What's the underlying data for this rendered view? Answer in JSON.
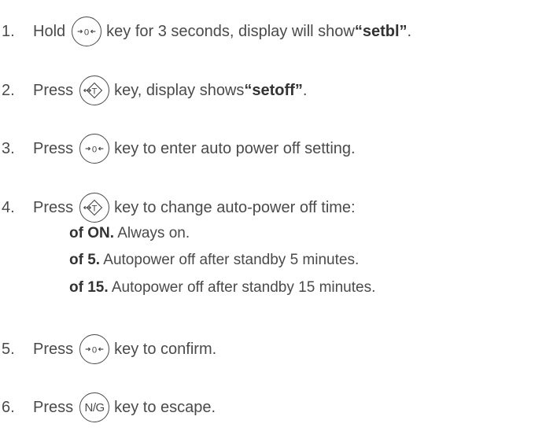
{
  "steps": [
    {
      "num": "1.",
      "before": "Hold",
      "key": "zero-key",
      "after": "key for 3 seconds, display will show ",
      "bold": "“setbl”",
      "tail": "."
    },
    {
      "num": "2.",
      "before": "Press",
      "key": "tare-key",
      "after": "key, display shows ",
      "bold": "“setoff”",
      "tail": "."
    },
    {
      "num": "3.",
      "before": "Press",
      "key": "zero-key",
      "after": "key to enter auto power off setting.",
      "bold": "",
      "tail": ""
    },
    {
      "num": "4.",
      "before": "Press",
      "key": "tare-key",
      "after": "key to change auto-power off time:",
      "bold": "",
      "tail": ""
    },
    {
      "num": "5.",
      "before": "Press",
      "key": "zero-key",
      "after": "key to confirm.",
      "bold": "",
      "tail": ""
    },
    {
      "num": "6.",
      "before": "Press",
      "key": "ng-key",
      "after": "key to escape.",
      "bold": "",
      "tail": ""
    }
  ],
  "options": [
    {
      "code": "of ON.",
      "desc": " Always on."
    },
    {
      "code": "of 5.",
      "desc": " Autopower off after standby 5 minutes."
    },
    {
      "code": "of 15.",
      "desc": " Autopower off after standby 15 minutes."
    }
  ],
  "keys": {
    "zero_key_icon": "zero-arrows-icon",
    "tare_key_icon": "tare-arrow-icon",
    "ng_key_label": "N/G"
  }
}
